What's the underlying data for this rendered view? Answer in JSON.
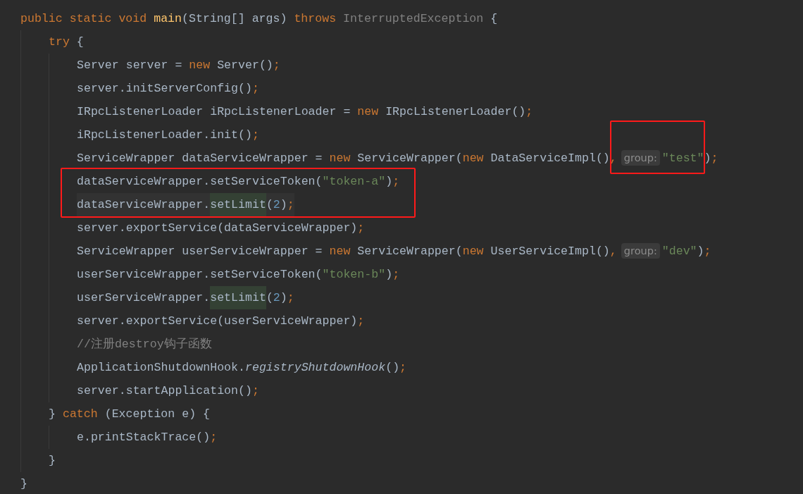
{
  "lines": [
    {
      "tokens": [
        {
          "kind": "keyword",
          "text": "public static void "
        },
        {
          "kind": "declaration",
          "text": "main"
        },
        {
          "kind": "text",
          "text": "(String[] args) "
        },
        {
          "kind": "keyword",
          "text": "throws "
        },
        {
          "kind": "unused",
          "text": "InterruptedException"
        },
        {
          "kind": "text",
          "text": " {"
        }
      ],
      "children": [
        {
          "tokens": [
            {
              "kind": "keyword",
              "text": "try"
            },
            {
              "kind": "text",
              "text": " {"
            }
          ],
          "children": [
            {
              "tokens": [
                {
                  "kind": "text",
                  "text": "Server server = "
                },
                {
                  "kind": "keyword",
                  "text": "new"
                },
                {
                  "kind": "text",
                  "text": " Server()"
                },
                {
                  "kind": "punct",
                  "text": ";"
                }
              ]
            },
            {
              "tokens": [
                {
                  "kind": "text",
                  "text": "server.initServerConfig()"
                },
                {
                  "kind": "punct",
                  "text": ";"
                }
              ]
            },
            {
              "tokens": [
                {
                  "kind": "text",
                  "text": "IRpcListenerLoader iRpcListenerLoader = "
                },
                {
                  "kind": "keyword",
                  "text": "new"
                },
                {
                  "kind": "text",
                  "text": " IRpcListenerLoader()"
                },
                {
                  "kind": "punct",
                  "text": ";"
                }
              ]
            },
            {
              "tokens": [
                {
                  "kind": "text",
                  "text": "iRpcListenerLoader.init()"
                },
                {
                  "kind": "punct",
                  "text": ";"
                }
              ]
            },
            {
              "tokens": [
                {
                  "kind": "text",
                  "text": "ServiceWrapper dataServiceWrapper = "
                },
                {
                  "kind": "keyword",
                  "text": "new"
                },
                {
                  "kind": "text",
                  "text": " ServiceWrapper("
                },
                {
                  "kind": "keyword",
                  "text": "new"
                },
                {
                  "kind": "text",
                  "text": " DataServiceImpl()"
                },
                {
                  "kind": "punct",
                  "text": ","
                },
                {
                  "kind": "hint",
                  "text": "group:",
                  "boxed": true
                },
                {
                  "kind": "string",
                  "text": "\"test\"",
                  "boxed": true
                },
                {
                  "kind": "text",
                  "text": ")"
                },
                {
                  "kind": "punct",
                  "text": ";"
                }
              ]
            },
            {
              "boxed": true,
              "tokens": [
                {
                  "kind": "text",
                  "text": "dataServiceWrapper.setServiceToken("
                },
                {
                  "kind": "string",
                  "text": "\"token-a\""
                },
                {
                  "kind": "text",
                  "text": ")"
                },
                {
                  "kind": "punct",
                  "text": ";"
                }
              ]
            },
            {
              "boxed": true,
              "current": true,
              "tokens": [
                {
                  "kind": "text",
                  "text": "dataServiceWrapper."
                },
                {
                  "kind": "usage",
                  "text": "setLimit"
                },
                {
                  "kind": "text",
                  "text": "("
                },
                {
                  "kind": "number",
                  "text": "2"
                },
                {
                  "kind": "text",
                  "text": ")"
                },
                {
                  "kind": "punct",
                  "text": ";"
                }
              ]
            },
            {
              "tokens": [
                {
                  "kind": "text",
                  "text": "server.exportService(dataServiceWrapper)"
                },
                {
                  "kind": "punct",
                  "text": ";"
                }
              ]
            },
            {
              "tokens": [
                {
                  "kind": "text",
                  "text": "ServiceWrapper userServiceWrapper = "
                },
                {
                  "kind": "keyword",
                  "text": "new"
                },
                {
                  "kind": "text",
                  "text": " ServiceWrapper("
                },
                {
                  "kind": "keyword",
                  "text": "new"
                },
                {
                  "kind": "text",
                  "text": " UserServiceImpl()"
                },
                {
                  "kind": "punct",
                  "text": ","
                },
                {
                  "kind": "hint",
                  "text": "group:"
                },
                {
                  "kind": "string",
                  "text": "\"dev\""
                },
                {
                  "kind": "text",
                  "text": ")"
                },
                {
                  "kind": "punct",
                  "text": ";"
                }
              ]
            },
            {
              "tokens": [
                {
                  "kind": "text",
                  "text": "userServiceWrapper.setServiceToken("
                },
                {
                  "kind": "string",
                  "text": "\"token-b\""
                },
                {
                  "kind": "text",
                  "text": ")"
                },
                {
                  "kind": "punct",
                  "text": ";"
                }
              ]
            },
            {
              "tokens": [
                {
                  "kind": "text",
                  "text": "userServiceWrapper."
                },
                {
                  "kind": "usage",
                  "text": "setLimit"
                },
                {
                  "kind": "text",
                  "text": "("
                },
                {
                  "kind": "number",
                  "text": "2"
                },
                {
                  "kind": "text",
                  "text": ")"
                },
                {
                  "kind": "punct",
                  "text": ";"
                }
              ]
            },
            {
              "tokens": [
                {
                  "kind": "text",
                  "text": "server.exportService(userServiceWrapper)"
                },
                {
                  "kind": "punct",
                  "text": ";"
                }
              ]
            },
            {
              "tokens": [
                {
                  "kind": "comment",
                  "text": "//注册destroy钩子函数"
                }
              ]
            },
            {
              "tokens": [
                {
                  "kind": "text",
                  "text": "ApplicationShutdownHook."
                },
                {
                  "kind": "static_call",
                  "text": "registryShutdownHook"
                },
                {
                  "kind": "text",
                  "text": "()"
                },
                {
                  "kind": "punct",
                  "text": ";"
                }
              ]
            },
            {
              "tokens": [
                {
                  "kind": "text",
                  "text": "server.startApplication()"
                },
                {
                  "kind": "punct",
                  "text": ";"
                }
              ]
            }
          ]
        },
        {
          "tokens": [
            {
              "kind": "text",
              "text": "} "
            },
            {
              "kind": "keyword",
              "text": "catch"
            },
            {
              "kind": "text",
              "text": " (Exception e) {"
            }
          ],
          "children": [
            {
              "tokens": [
                {
                  "kind": "text",
                  "text": "e.printStackTrace()"
                },
                {
                  "kind": "punct",
                  "text": ";"
                }
              ]
            }
          ]
        },
        {
          "tokens": [
            {
              "kind": "text",
              "text": "}"
            }
          ]
        }
      ]
    },
    {
      "tokens": [
        {
          "kind": "text",
          "text": "}"
        }
      ]
    }
  ]
}
